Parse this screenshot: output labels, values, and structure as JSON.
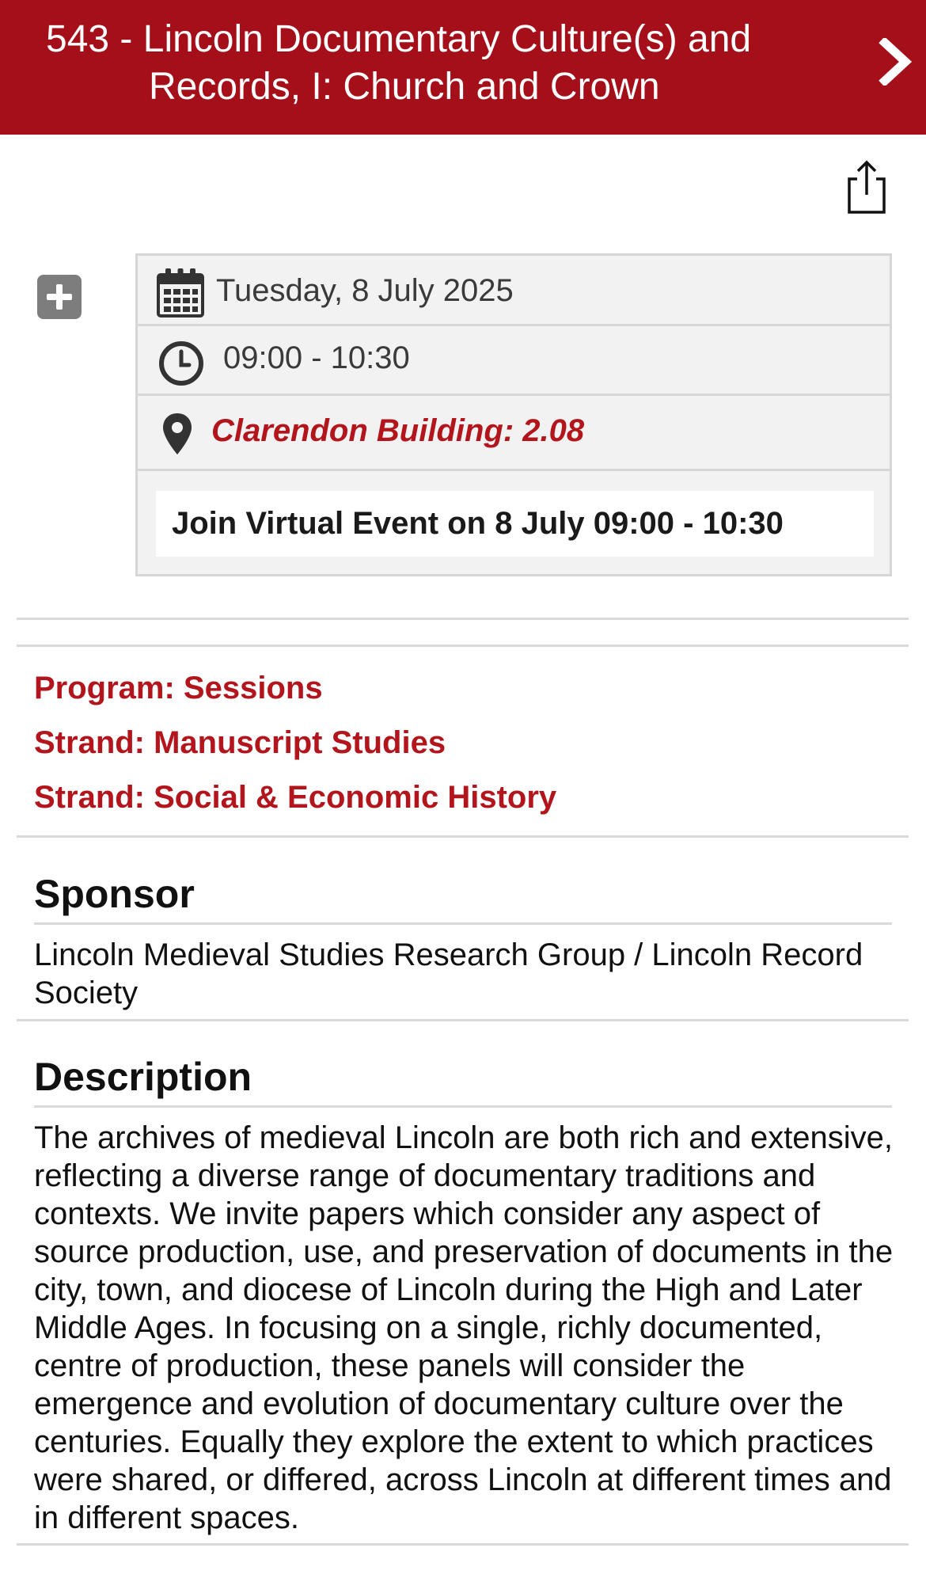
{
  "header": {
    "title": "543 - Lincoln Documentary Culture(s) and Records, I: Church and Crown",
    "next_icon": "chevron-right-icon",
    "background": "#a50f19"
  },
  "toolbar": {
    "share_icon": "share-icon",
    "add_icon": "plus-square-icon"
  },
  "session": {
    "date": "Tuesday, 8 July 2025",
    "time": "09:00 - 10:30",
    "location": "Clarendon Building: 2.08",
    "virtual_label": "Join Virtual Event on 8 July 09:00 - 10:30"
  },
  "categories": [
    "Program: Sessions",
    "Strand: Manuscript Studies",
    "Strand: Social & Economic History"
  ],
  "sponsor": {
    "heading": "Sponsor",
    "text": "Lincoln Medieval Studies Research Group / Lincoln Record Society"
  },
  "description": {
    "heading": "Description",
    "text": "The archives of medieval Lincoln are both rich and extensive, reflecting a diverse range of documentary traditions and contexts. We invite papers which consider any aspect of source production, use, and preservation of documents in the city, town, and diocese of Lincoln during the High and Later Middle Ages. In focusing on a single, richly documented, centre of production, these panels will consider the emergence and evolution of documentary culture over the centuries. Equally they explore the extent to which practices were shared, or differed, across Lincoln at different times and in different spaces."
  },
  "colors": {
    "accent": "#b3151c",
    "header_bg": "#a50f19",
    "box_bg": "#f2f2f2"
  }
}
